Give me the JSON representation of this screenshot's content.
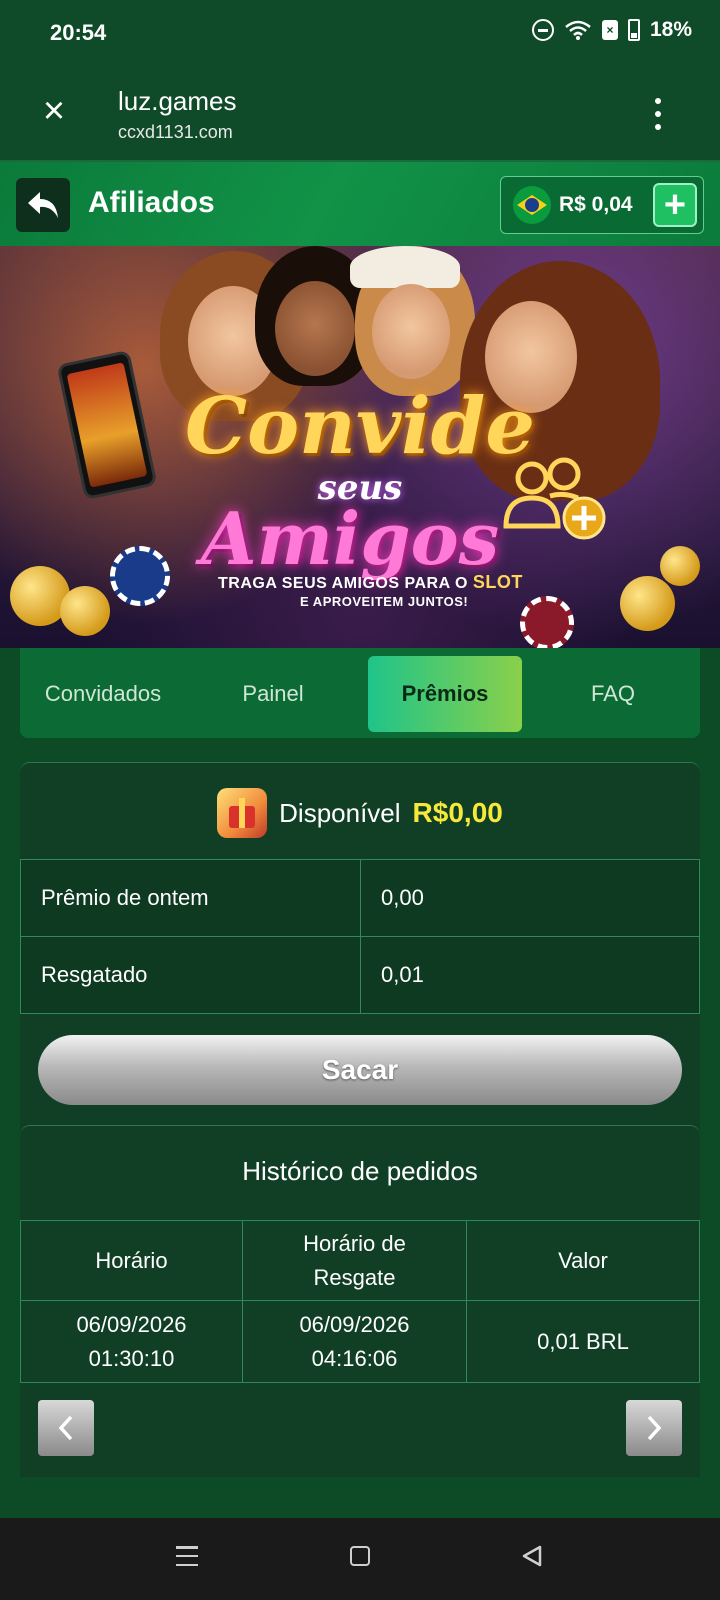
{
  "status": {
    "time": "20:54",
    "battery": "18%"
  },
  "browser": {
    "title": "luz.games",
    "domain": "ccxd1131.com"
  },
  "header": {
    "title": "Afiliados",
    "balance": "R$ 0,04"
  },
  "banner": {
    "line1": "Convide",
    "line2": "seus",
    "line3": "Amigos",
    "sub1_a": "TRAGA SEUS AMIGOS PARA O ",
    "sub1_b": "SLOT",
    "sub2": "E APROVEITEM JUNTOS!"
  },
  "tabs": [
    {
      "label": "Convidados",
      "active": false
    },
    {
      "label": "Painel",
      "active": false
    },
    {
      "label": "Prêmios",
      "active": true
    },
    {
      "label": "FAQ",
      "active": false
    }
  ],
  "rewards": {
    "available_label": "Disponível",
    "available_value": "R$0,00",
    "rows": [
      {
        "label": "Prêmio de ontem",
        "value": "0,00"
      },
      {
        "label": "Resgatado",
        "value": "0,01"
      }
    ],
    "withdraw_label": "Sacar"
  },
  "history": {
    "title": "Histórico de pedidos",
    "headers": [
      "Horário",
      "Horário de Resgate",
      "Valor"
    ],
    "rows": [
      {
        "time_date": "06/09/2026",
        "time_clock": "01:30:10",
        "redeem_date": "06/09/2026",
        "redeem_clock": "04:16:06",
        "value": "0,01 BRL"
      }
    ]
  },
  "colors": {
    "accent": "#f6e93a",
    "tab_active_start": "#1fc48a",
    "tab_active_end": "#8ad04a",
    "bg": "#0d4a26"
  }
}
